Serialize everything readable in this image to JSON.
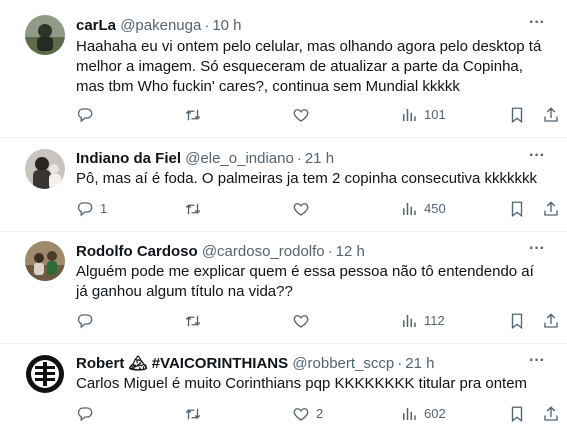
{
  "tweets": [
    {
      "name": "carLa",
      "handle": "@pakenuga",
      "dot": "·",
      "time": "10 h",
      "text": "Haahaha eu vi ontem pelo celular, mas olhando agora pelo desktop tá melhor a imagem. Só esqueceram de atualizar a parte da Copinha, mas tbm Who fuckin' cares?, continua sem Mundial kkkkk",
      "replies": "",
      "retweets": "",
      "likes": "",
      "views": "101"
    },
    {
      "name": "Indiano da Fiel",
      "handle": "@ele_o_indiano",
      "dot": "·",
      "time": "21 h",
      "text": "Pô, mas aí é foda. O palmeiras ja tem 2 copinha consecutiva kkkkkkk",
      "replies": "1",
      "retweets": "",
      "likes": "",
      "views": "450"
    },
    {
      "name": "Rodolfo Cardoso",
      "handle": "@cardoso_rodolfo",
      "dot": "·",
      "time": "12 h",
      "text": "Alguém pode me explicar quem é essa pessoa não tô entendendo aí já ganhou algum título na vida??",
      "replies": "",
      "retweets": "",
      "likes": "",
      "views": "112"
    },
    {
      "name": "Robert",
      "name_emoji": "🏔",
      "name_tag": "#VAICORINTHIANS",
      "handle": "@robbert_sccp",
      "dot": "·",
      "time": "21 h",
      "text": "Carlos Miguel é muito Corinthians pqp KKKKKKKK titular pra ontem",
      "replies": "",
      "retweets": "",
      "likes": "2",
      "views": "602"
    }
  ],
  "icons": {
    "more": "more-icon",
    "reply": "reply-icon",
    "retweet": "retweet-icon",
    "like": "heart-icon",
    "views": "views-icon",
    "bookmark": "bookmark-icon",
    "share": "share-icon"
  },
  "colors": {
    "text": "#0f1419",
    "secondary": "#536471",
    "divider": "#eff3f4"
  }
}
